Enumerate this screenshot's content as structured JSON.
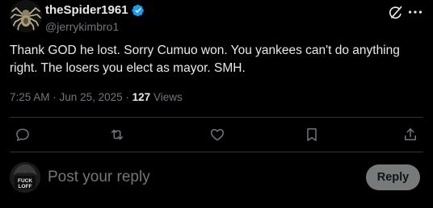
{
  "author": {
    "display_name": "theSpider1961",
    "handle": "@jerrykimbro1"
  },
  "post": {
    "text": "Thank GOD he lost. Sorry Cumuo won. You yankees can't do anything right. The losers you elect as mayor. SMH.",
    "time": "7:25 AM",
    "date": "Jun 25, 2025",
    "views_count": "127",
    "views_label": "Views"
  },
  "reply": {
    "placeholder": "Post your reply",
    "button_label": "Reply",
    "avatar_text": "FUCK LOFF"
  },
  "icons": {
    "header": [
      "verified-badge-icon",
      "grok-icon",
      "more-icon"
    ],
    "actions": [
      "reply-icon",
      "repost-icon",
      "like-icon",
      "bookmark-icon",
      "share-icon"
    ]
  },
  "colors": {
    "background": "#000000",
    "text": "#e7e9ea",
    "muted": "#71767b",
    "divider": "#2f3336",
    "verified": "#1d9bf0",
    "reply_button": "#787a7a"
  }
}
